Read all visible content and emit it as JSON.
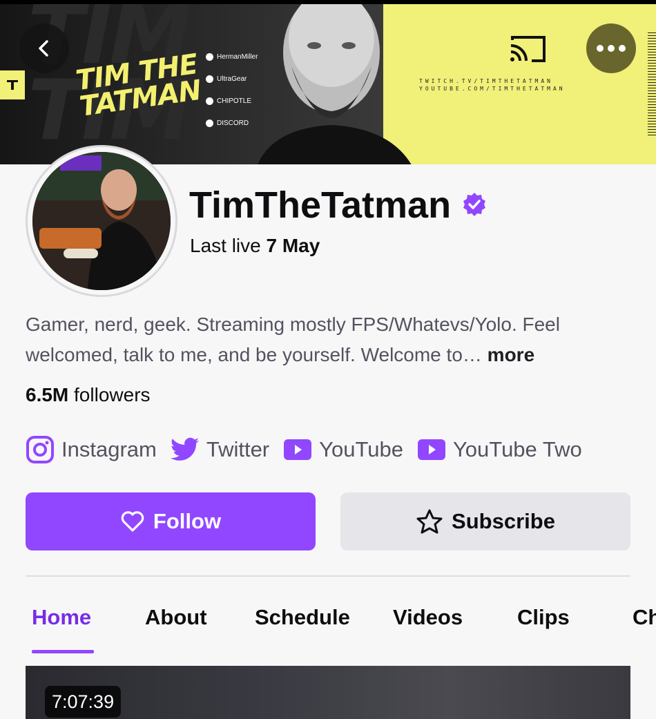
{
  "banner": {
    "logo_text_line1": "TIM THE",
    "logo_text_line2": "TATMAN",
    "sponsors": [
      "HermanMiller",
      "UltraGear",
      "CHIPOTLE",
      "DISCORD"
    ],
    "url_line1": "TWITCH.TV/TIMTHETATMAN",
    "url_line2": "YOUTUBE.COM/TIMTHETATMAN"
  },
  "profile": {
    "name": "TimTheTatman",
    "last_live_prefix": "Last live",
    "last_live_date": "7 May",
    "bio": "Gamer, nerd, geek. Streaming mostly FPS/Whatevs/Yolo. Feel welcomed, talk to me, and be yourself. Welcome to…",
    "bio_more": "more",
    "followers_count": "6.5M",
    "followers_label": "followers"
  },
  "socials": [
    {
      "label": "Instagram",
      "icon": "instagram-icon"
    },
    {
      "label": "Twitter",
      "icon": "twitter-icon"
    },
    {
      "label": "YouTube",
      "icon": "youtube-icon"
    },
    {
      "label": "YouTube Two",
      "icon": "youtube-icon"
    }
  ],
  "actions": {
    "follow_label": "Follow",
    "subscribe_label": "Subscribe"
  },
  "tabs": [
    "Home",
    "About",
    "Schedule",
    "Videos",
    "Clips",
    "Ch"
  ],
  "active_tab": "Home",
  "video": {
    "duration": "7:07:39"
  },
  "colors": {
    "accent": "#9147ff",
    "banner_yellow": "#f1f079"
  }
}
